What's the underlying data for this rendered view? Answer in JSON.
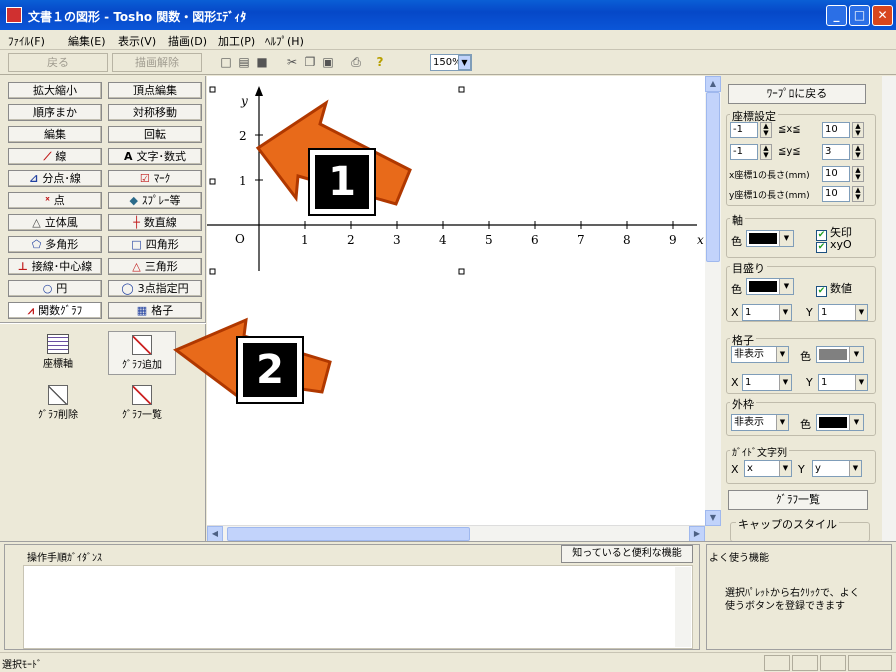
{
  "window": {
    "title": "文書１の図形 - Tosho 関数・図形ｴﾃﾞｨﾀ"
  },
  "menu": [
    "ﾌｧｲﾙ(F)",
    "編集(E)",
    "表示(V)",
    "描画(D)",
    "加工(P)",
    "ﾍﾙﾌﾟ(H)"
  ],
  "toolbar": {
    "back": "戻る",
    "undo_draw": "描画解除",
    "zoom": "150%"
  },
  "left_buttons": [
    {
      "label": "拡大縮小",
      "icon": ""
    },
    {
      "label": "頂点編集",
      "icon": ""
    },
    {
      "label": "順序まか",
      "icon": ""
    },
    {
      "label": "対称移動",
      "icon": ""
    },
    {
      "label": "編集",
      "icon": ""
    },
    {
      "label": "回転",
      "icon": ""
    },
    {
      "label": "線",
      "icon": "line-icon"
    },
    {
      "label": "文字･数式",
      "icon": "text-icon"
    },
    {
      "label": "分点･線",
      "icon": "division-icon"
    },
    {
      "label": "ﾏｰｸ",
      "icon": "mark-icon"
    },
    {
      "label": "点",
      "icon": "point-icon"
    },
    {
      "label": "ｽﾌﾟﾚｰ等",
      "icon": "spray-icon"
    },
    {
      "label": "立体風",
      "icon": "solid-icon"
    },
    {
      "label": "数直線",
      "icon": "number-line-icon"
    },
    {
      "label": "多角形",
      "icon": "polygon-icon"
    },
    {
      "label": "四角形",
      "icon": "rectangle-icon"
    },
    {
      "label": "接線･中心線",
      "icon": "tangent-icon"
    },
    {
      "label": "三角形",
      "icon": "triangle-icon"
    },
    {
      "label": "円",
      "icon": "circle-icon"
    },
    {
      "label": "3点指定円",
      "icon": "three-point-circle-icon"
    },
    {
      "label": "関数ｸﾞﾗﾌ",
      "icon": "function-graph-icon"
    },
    {
      "label": "格子",
      "icon": "grid-icon"
    }
  ],
  "graph_tools": [
    {
      "label": "座標軸"
    },
    {
      "label": "ｸﾞﾗﾌ追加"
    },
    {
      "label": "ｸﾞﾗﾌ削除"
    },
    {
      "label": "ｸﾞﾗﾌ一覧"
    }
  ],
  "callouts": [
    "1",
    "2"
  ],
  "axes": {
    "x_label": "x",
    "y_label": "y",
    "origin": "O",
    "x_ticks": [
      "1",
      "2",
      "3",
      "4",
      "5",
      "6",
      "7",
      "8",
      "9"
    ],
    "y_ticks": [
      "1",
      "2"
    ]
  },
  "right": {
    "back_button": "ﾜｰﾌﾟﾛに戻る",
    "coord_group": "座標設定",
    "x_min": "-1",
    "x_max": "10",
    "x_range_label": "≦x≦",
    "y_min": "-1",
    "y_max": "3",
    "y_range_label": "≦y≦",
    "x_len_label": "x座標1の長さ(mm)",
    "x_len": "10",
    "y_len_label": "y座標1の長さ(mm)",
    "y_len": "10",
    "axis_group": "軸",
    "color_label": "色",
    "arrow_label": "矢印",
    "xyo_label": "xyO",
    "scale_group": "目盛り",
    "value_label": "数値",
    "x_label": "X",
    "y_label": "Y",
    "scale_x": "1",
    "scale_y": "1",
    "grid_group": "格子",
    "grid_display": "非表示",
    "grid_x": "1",
    "grid_y": "1",
    "frame_group": "外枠",
    "frame_display": "非表示",
    "guide_group": "ｶﾞｲﾄﾞ文字列",
    "guide_x": "x",
    "guide_y": "y",
    "graph_list_button": "ｸﾞﾗﾌ一覧",
    "cap_group": "キャップのスタイル",
    "colors": {
      "axis": "#000000",
      "scale": "#000000",
      "grid": "#808080",
      "frame": "#000000"
    }
  },
  "bottom": {
    "guide_title": "操作手順ｶﾞｲﾀﾞﾝｽ",
    "useful_button": "知っていると便利な機能",
    "freq_title": "よく使う機能",
    "freq_text": "選択ﾊﾟﾚｯﾄから右ｸﾘｯｸで、よく使うボタンを登録できます"
  },
  "status": {
    "mode": "選択ﾓｰﾄﾞ"
  }
}
